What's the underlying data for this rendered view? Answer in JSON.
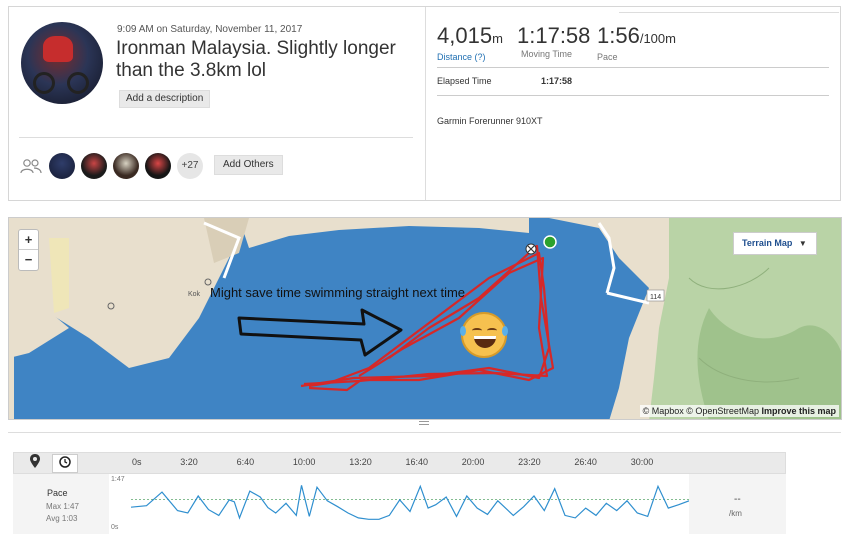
{
  "activity": {
    "timestamp": "9:09 AM on Saturday, November 11, 2017",
    "title": "Ironman Malaysia. Slightly longer than the 3.8km lol",
    "add_description_label": "Add a description",
    "add_others_label": "Add Others",
    "more_athletes": "+27"
  },
  "stats": {
    "distance": {
      "value": "4,015",
      "unit": "m",
      "label": "Distance (?)"
    },
    "moving_time": {
      "value": "1:17:58",
      "label": "Moving Time"
    },
    "pace": {
      "value": "1:56",
      "unit": "/100m",
      "label": "Pace"
    },
    "elapsed_label": "Elapsed Time",
    "elapsed_value": "1:17:58",
    "device": "Garmin Forerunner 910XT"
  },
  "map": {
    "zoom_in": "+",
    "zoom_out": "−",
    "terrain_label": "Terrain Map",
    "attribution_mapbox": "© Mapbox",
    "attribution_osm": "© OpenStreetMap",
    "attribution_improve": "Improve this map",
    "annotation": "Might save time swimming straight next time",
    "road_label": "114",
    "place_label": "Kok",
    "colors": {
      "water": "#3f84c4",
      "land": "#e8dfcd",
      "route": "#d62828",
      "forest": "#a9c99a"
    }
  },
  "chart": {
    "metric_name": "Pace",
    "metric_max": "Max 1:47",
    "metric_avg": "Avg 1:03",
    "y_top_label": "1:47",
    "y_bottom_label": "0s",
    "readout_value": "--",
    "readout_unit": "/km",
    "time_ticks": [
      "0s",
      "3:20",
      "6:40",
      "10:00",
      "13:20",
      "16:40",
      "20:00",
      "23:20",
      "26:40",
      "30:00"
    ]
  },
  "chart_data": {
    "type": "line",
    "title": "",
    "xlabel": "",
    "ylabel": "",
    "x_unit": "seconds",
    "x": [
      0,
      60,
      120,
      180,
      220,
      260,
      300,
      340,
      380,
      400,
      420,
      460,
      500,
      530,
      560,
      600,
      640,
      660,
      690,
      720,
      760,
      800,
      840,
      880,
      920,
      960,
      1000,
      1040,
      1080,
      1120,
      1150,
      1180,
      1220,
      1260,
      1300,
      1340,
      1380,
      1420,
      1440,
      1480,
      1520,
      1560,
      1600,
      1640,
      1680,
      1720,
      1760,
      1800,
      1840,
      1880,
      1920,
      1960,
      2000,
      2040,
      2080,
      2120,
      2160
    ],
    "series": [
      {
        "name": "",
        "values": [
          47,
          50,
          78,
          40,
          35,
          70,
          42,
          30,
          62,
          58,
          25,
          80,
          68,
          46,
          35,
          55,
          30,
          92,
          28,
          88,
          60,
          48,
          35,
          25,
          22,
          22,
          30,
          62,
          38,
          90,
          45,
          52,
          68,
          28,
          70,
          45,
          32,
          60,
          50,
          30,
          48,
          70,
          40,
          85,
          30,
          25,
          45,
          30,
          55,
          40,
          60,
          35,
          28,
          90,
          45,
          52,
          60
        ]
      }
    ],
    "ylim": [
      0,
      107
    ],
    "y_unit": "seconds per 100m",
    "avg_line": 63
  }
}
